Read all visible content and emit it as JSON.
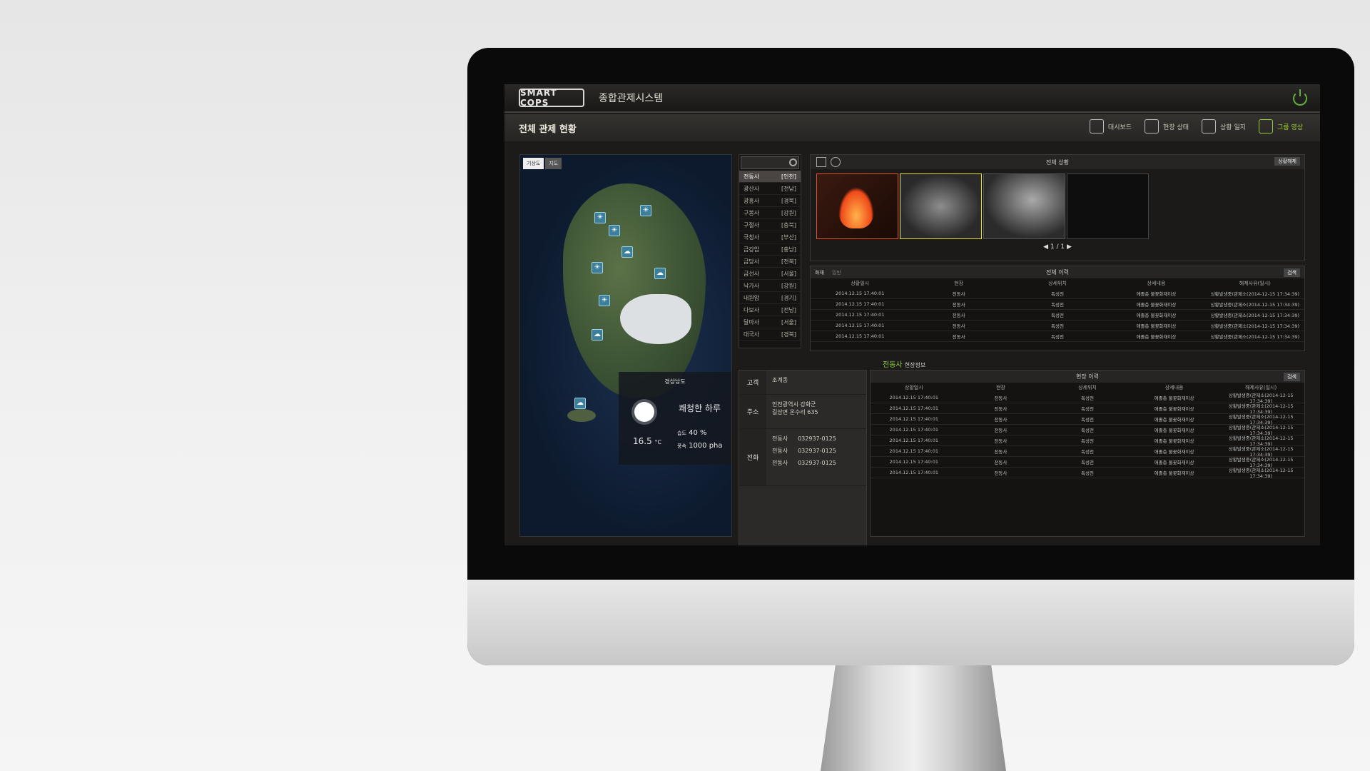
{
  "header": {
    "logo": "SMART COPS",
    "system_title": "종합관제시스템"
  },
  "subheader": {
    "page_title": "전체 관제 현황"
  },
  "nav": [
    {
      "label": "대시보드",
      "icon": "dashboard-icon",
      "active": false
    },
    {
      "label": "현장 상태",
      "icon": "site-status-icon",
      "active": false
    },
    {
      "label": "상황 일지",
      "icon": "log-icon",
      "active": false
    },
    {
      "label": "그룹 영상",
      "icon": "camera-icon",
      "active": true
    }
  ],
  "map": {
    "tabs": [
      "기상도",
      "지도"
    ],
    "weather": {
      "location": "경상남도",
      "description": "쾌청한 하루",
      "temperature": "16.5",
      "temp_unit": "°C",
      "humidity_label": "습도",
      "humidity": "40 %",
      "pressure_label": "풍속",
      "pressure": "1000 pha"
    }
  },
  "list": {
    "header": [
      "전동사",
      "[인천]"
    ],
    "rows": [
      [
        "광산사",
        "[전남]"
      ],
      [
        "광흥사",
        "[경북]"
      ],
      [
        "구봉사",
        "[강원]"
      ],
      [
        "구절사",
        "[충북]"
      ],
      [
        "국청사",
        "[부산]"
      ],
      [
        "금강암",
        "[충남]"
      ],
      [
        "금당사",
        "[전북]"
      ],
      [
        "금선사",
        "[서울]"
      ],
      [
        "낙가사",
        "[강원]"
      ],
      [
        "내원암",
        "[경기]"
      ],
      [
        "다보사",
        "[전남]"
      ],
      [
        "달마사",
        "[서울]"
      ],
      [
        "대국사",
        "[경북]"
      ]
    ]
  },
  "cameras": {
    "title": "전체 상황",
    "page": "1 / 1",
    "action": "상황해제"
  },
  "history": {
    "title": "전체 이력",
    "tabs": [
      "화재",
      "일반"
    ],
    "button": "검색",
    "columns": [
      "상황일시",
      "현장",
      "상세위치",
      "상세내용",
      "해제사유(일시)"
    ],
    "rows": [
      [
        "2014.12.15 17:40:01",
        "전동사",
        "독성전",
        "애졸층 불꽃화재이상",
        "상황발생중(관제소(2014-12-15 17:34:39)"
      ],
      [
        "2014.12.15 17:40:01",
        "전동사",
        "독성전",
        "애졸층 불꽃화재이상",
        "상황발생중(관제소(2014-12-15 17:34:39)"
      ],
      [
        "2014.12.15 17:40:01",
        "전동사",
        "독성전",
        "애졸층 불꽃화재이상",
        "상황발생중(관제소(2014-12-15 17:34:39)"
      ],
      [
        "2014.12.15 17:40:01",
        "전동사",
        "독성전",
        "애졸층 불꽃화재이상",
        "상황발생중(관제소(2014-12-15 17:34:39)"
      ],
      [
        "2014.12.15 17:40:01",
        "전동사",
        "독성전",
        "애졸층 불꽃화재이상",
        "상황발생중(관제소(2014-12-15 17:34:39)"
      ]
    ]
  },
  "site": {
    "name": "전동사",
    "subtitle": "현장정보",
    "customer_label": "고객",
    "customer": "조계종",
    "address_label": "주소",
    "address": [
      "인천광역시 강화군",
      "길상면 온수리 635"
    ],
    "phone_label": "전화",
    "phones": [
      [
        "전동사",
        "032937-0125"
      ],
      [
        "전동사",
        "032937-0125"
      ],
      [
        "전동사",
        "032937-0125"
      ]
    ]
  },
  "site_history": {
    "title": "현장 이력",
    "button": "검색",
    "columns": [
      "상황일시",
      "현장",
      "상세위치",
      "상세내용",
      "해제사유(일시)"
    ],
    "rows": [
      [
        "2014.12.15 17:40:01",
        "전동사",
        "독성전",
        "애졸층 불꽃화재이상",
        "상황발생중(관제소(2014-12-15 17:34:39)"
      ],
      [
        "2014.12.15 17:40:01",
        "전동사",
        "독성전",
        "애졸층 불꽃화재이상",
        "상황발생중(관제소(2014-12-15 17:34:39)"
      ],
      [
        "2014.12.15 17:40:01",
        "전동사",
        "독성전",
        "애졸층 불꽃화재이상",
        "상황발생중(관제소(2014-12-15 17:34:39)"
      ],
      [
        "2014.12.15 17:40:01",
        "전동사",
        "독성전",
        "애졸층 불꽃화재이상",
        "상황발생중(관제소(2014-12-15 17:34:39)"
      ],
      [
        "2014.12.15 17:40:01",
        "전동사",
        "독성전",
        "애졸층 불꽃화재이상",
        "상황발생중(관제소(2014-12-15 17:34:39)"
      ],
      [
        "2014.12.15 17:40:01",
        "전동사",
        "독성전",
        "애졸층 불꽃화재이상",
        "상황발생중(관제소(2014-12-15 17:34:39)"
      ],
      [
        "2014.12.15 17:40:01",
        "전동사",
        "독성전",
        "애졸층 불꽃화재이상",
        "상황발생중(관제소(2014-12-15 17:34:39)"
      ],
      [
        "2014.12.15 17:40:01",
        "전동사",
        "독성전",
        "애졸층 불꽃화재이상",
        "상황발생중(관제소(2014-12-15 17:34:39)"
      ]
    ]
  },
  "colors": {
    "accent_green": "#8fcf3a",
    "alert_orange": "#e0552a",
    "alert_yellow": "#e8e030"
  }
}
